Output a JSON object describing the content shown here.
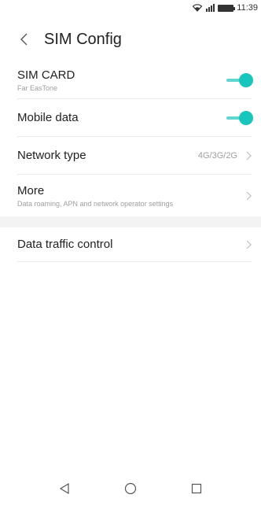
{
  "status_bar": {
    "time": "11:39",
    "icons": [
      "wifi-icon",
      "signal-icon",
      "battery-icon"
    ]
  },
  "header": {
    "back_icon": "chevron-left-icon",
    "title": "SIM Config"
  },
  "settings": {
    "sim_card": {
      "title": "SIM CARD",
      "subtitle": "Far EasTone",
      "toggle_on": true
    },
    "mobile_data": {
      "title": "Mobile data",
      "toggle_on": true
    },
    "network_type": {
      "title": "Network type",
      "value": "4G/3G/2G"
    },
    "more": {
      "title": "More",
      "subtitle": "Data roaming, APN and network operator settings"
    },
    "data_traffic": {
      "title": "Data traffic control"
    }
  },
  "nav": {
    "icons": [
      "back-triangle-icon",
      "home-circle-icon",
      "recents-square-icon"
    ]
  },
  "colors": {
    "accent": "#18c6bd",
    "accent_track": "#5fd6cf",
    "divider_band": "#f3f3f3",
    "secondary_text": "#9e9e9e"
  }
}
